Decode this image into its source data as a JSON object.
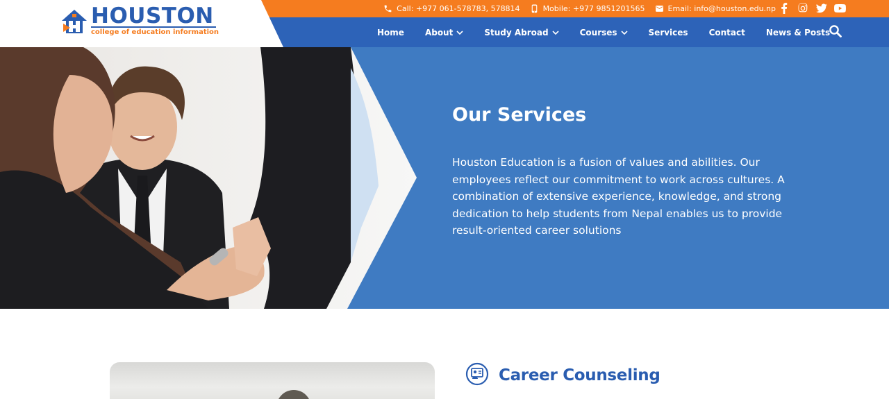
{
  "logo": {
    "title": "HOUSTON",
    "subtitle": "college of education information"
  },
  "topbar": {
    "call": "Call: +977 061-578783, 578814",
    "mobile": "Mobile: +977 9851201565",
    "email": "Email: info@houston.edu.np",
    "socials": [
      "facebook-icon",
      "instagram-icon",
      "twitter-icon",
      "youtube-icon"
    ]
  },
  "nav": {
    "items": [
      {
        "label": "Home",
        "dropdown": false
      },
      {
        "label": "About",
        "dropdown": true
      },
      {
        "label": "Study Abroad",
        "dropdown": true
      },
      {
        "label": "Courses",
        "dropdown": true
      },
      {
        "label": "Services",
        "dropdown": false
      },
      {
        "label": "Contact",
        "dropdown": false
      },
      {
        "label": "News & Posts",
        "dropdown": false
      }
    ]
  },
  "hero": {
    "title": "Our Services",
    "text": "Houston Education is a fusion of values and abilities. Our employees reflect our commitment to work across cultures. A combination of extensive experience, knowledge, and strong dedication to help students from Nepal enables us to provide result-oriented career solutions"
  },
  "service": {
    "title": "Career Counseling"
  },
  "colors": {
    "orange": "#f57c1f",
    "blue": "#2d63b8",
    "hero_blue": "#3f7bc2"
  }
}
